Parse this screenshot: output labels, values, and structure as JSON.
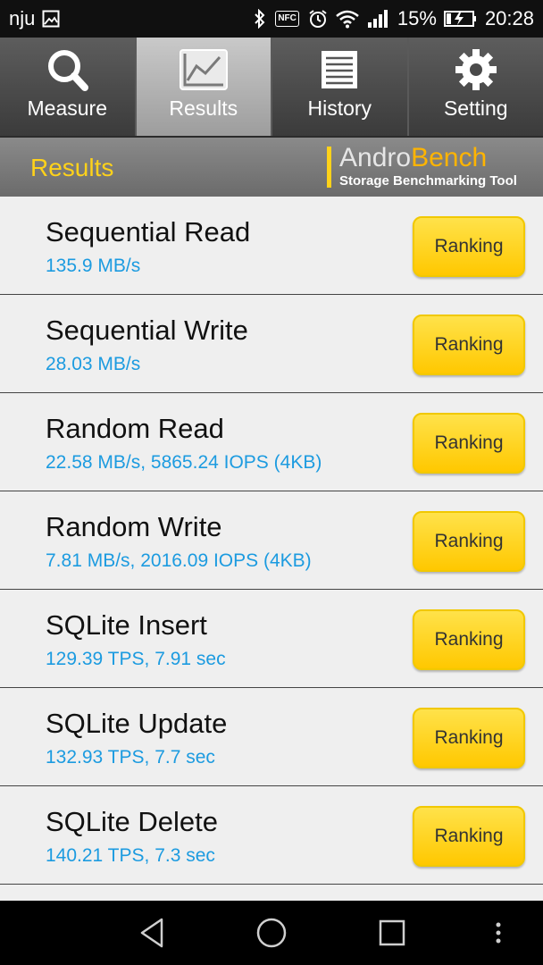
{
  "status_bar": {
    "carrier": "nju",
    "battery_percent": "15%",
    "time": "20:28",
    "nfc_label": "NFC",
    "icons": [
      "image-icon",
      "bluetooth-icon",
      "nfc-icon",
      "alarm-icon",
      "wifi-icon",
      "signal-icon",
      "battery-charging-icon"
    ]
  },
  "tabs": [
    {
      "label": "Measure",
      "icon": "search-icon",
      "active": false
    },
    {
      "label": "Results",
      "icon": "chart-icon",
      "active": true
    },
    {
      "label": "History",
      "icon": "document-icon",
      "active": false
    },
    {
      "label": "Setting",
      "icon": "gear-icon",
      "active": false
    }
  ],
  "header": {
    "title": "Results",
    "logo_andro": "Andro",
    "logo_bench": "Bench",
    "logo_tagline": "Storage Benchmarking Tool"
  },
  "results": [
    {
      "name": "Sequential Read",
      "value": "135.9 MB/s",
      "button": "Ranking"
    },
    {
      "name": "Sequential Write",
      "value": "28.03 MB/s",
      "button": "Ranking"
    },
    {
      "name": "Random Read",
      "value": "22.58 MB/s, 5865.24 IOPS (4KB)",
      "button": "Ranking"
    },
    {
      "name": "Random Write",
      "value": "7.81 MB/s, 2016.09 IOPS (4KB)",
      "button": "Ranking"
    },
    {
      "name": "SQLite Insert",
      "value": "129.39 TPS, 7.91 sec",
      "button": "Ranking"
    },
    {
      "name": "SQLite Update",
      "value": "132.93 TPS, 7.7 sec",
      "button": "Ranking"
    },
    {
      "name": "SQLite Delete",
      "value": "140.21 TPS, 7.3 sec",
      "button": "Ranking"
    }
  ],
  "colors": {
    "accent_yellow": "#ffd21a",
    "value_blue": "#1c9be0",
    "button_yellow": "#ffc800"
  },
  "nav": {
    "icons": [
      "back-icon",
      "home-icon",
      "recents-icon",
      "more-icon"
    ]
  }
}
